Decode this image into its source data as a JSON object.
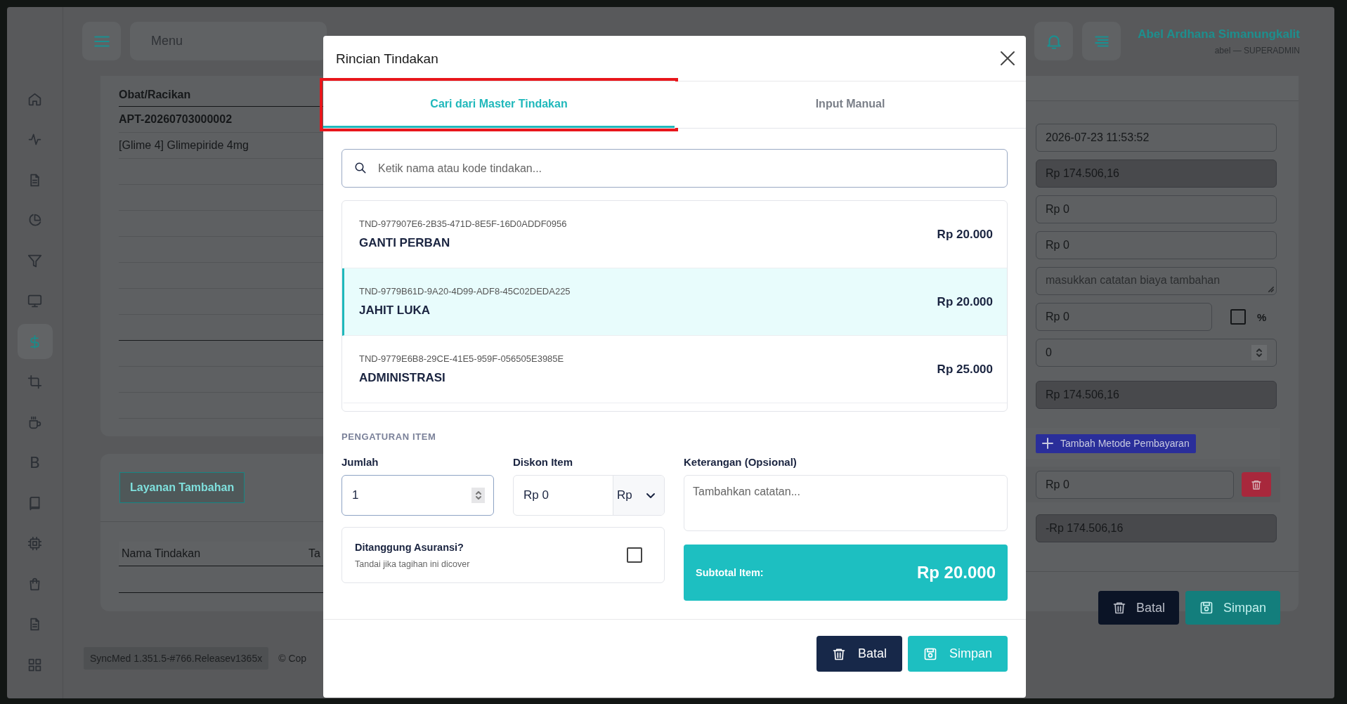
{
  "sidebar": [
    {
      "kind": "icon",
      "selected": false
    },
    {
      "kind": "icon",
      "selected": false
    },
    {
      "kind": "icon",
      "selected": false
    },
    {
      "kind": "icon",
      "selected": false
    },
    {
      "kind": "icon",
      "selected": false
    },
    {
      "kind": "icon",
      "selected": false
    },
    {
      "kind": "icon",
      "selected": true
    },
    {
      "kind": "icon",
      "selected": false
    },
    {
      "kind": "icon",
      "selected": false
    },
    {
      "kind": "letter",
      "text": "B",
      "selected": false
    },
    {
      "kind": "icon",
      "selected": false
    },
    {
      "kind": "icon",
      "selected": false
    },
    {
      "kind": "icon",
      "selected": false
    },
    {
      "kind": "icon",
      "selected": false
    },
    {
      "kind": "icon",
      "selected": false
    }
  ],
  "topbar": {
    "menu_search": "Menu",
    "user": {
      "name": "Abel Ardhana Simanungkalit",
      "role": "abel — SUPERADMIN"
    }
  },
  "obat_table": {
    "columns": [
      "Obat/Racikan"
    ],
    "rows": [
      {
        "kind": "group",
        "text": "APT-20260703000002"
      },
      {
        "kind": "item",
        "text": "[Glime 4] Glimepiride 4mg"
      }
    ]
  },
  "layanan": {
    "button": "Layanan Tambahan",
    "columns": [
      "Nama Tindakan",
      "Ta"
    ]
  },
  "footer": {
    "version": "SyncMed 1.351.5-#766.Releasev1365x",
    "copyright": "© Cop"
  },
  "payment_panel": {
    "fields": [
      {
        "kind": "text",
        "value": "2026-07-23 11:53:52",
        "disabled": false
      },
      {
        "kind": "text",
        "value": "Rp 174.506,16",
        "disabled": true
      },
      {
        "kind": "text",
        "value": "Rp 0",
        "disabled": false
      },
      {
        "kind": "text",
        "value": "Rp 0",
        "disabled": false
      },
      {
        "kind": "textarea",
        "placeholder": "masukkan catatan biaya tambahan"
      },
      {
        "kind": "percent",
        "value": "Rp 0",
        "checked": false,
        "unit": "%"
      },
      {
        "kind": "number",
        "value": "0"
      },
      {
        "kind": "text",
        "value": "Rp 174.506,16",
        "disabled": true
      }
    ],
    "add_button": "Tambah Metode Pembayaran",
    "payment": {
      "value": "Rp 0"
    },
    "balance": {
      "value": "-Rp 174.506,16",
      "disabled": true
    },
    "buttons": [
      {
        "kind": "cancel",
        "label": "Batal"
      },
      {
        "kind": "save",
        "label": "Simpan"
      }
    ]
  },
  "modal": {
    "title": "Rincian Tindakan",
    "tabs": [
      {
        "label": "Cari dari Master Tindakan",
        "selected": true,
        "highlighted": true
      },
      {
        "label": "Input Manual",
        "selected": false,
        "highlighted": false
      }
    ],
    "search": {
      "placeholder": "Ketik nama atau kode tindakan..."
    },
    "results": [
      {
        "code": "TND-977907E6-2B35-471D-8E5F-16D0ADDF0956",
        "name": "GANTI PERBAN",
        "price": "Rp 20.000",
        "selected": false
      },
      {
        "code": "TND-9779B61D-9A20-4D99-ADF8-45C02DEDA225",
        "name": "JAHIT LUKA",
        "price": "Rp 20.000",
        "selected": true
      },
      {
        "code": "TND-9779E6B8-29CE-41E5-959F-056505E3985E",
        "name": "ADMINISTRASI",
        "price": "Rp 25.000",
        "selected": false
      }
    ],
    "settings": {
      "heading": "PENGATURAN ITEM",
      "quantity": {
        "label": "Jumlah",
        "value": "1"
      },
      "discount": {
        "label": "Diskon Item",
        "value": "Rp 0",
        "unit": "Rp"
      },
      "note": {
        "label": "Keterangan (Opsional)",
        "placeholder": "Tambahkan catatan..."
      },
      "insurance": {
        "title": "Ditanggung Asuransi?",
        "hint": "Tandai jika tagihan ini dicover",
        "checked": false
      },
      "subtotal": {
        "label": "Subtotal Item:",
        "value": "Rp 20.000"
      }
    },
    "buttons": [
      {
        "kind": "cancel",
        "label": "Batal"
      },
      {
        "kind": "save",
        "label": "Simpan"
      }
    ]
  }
}
